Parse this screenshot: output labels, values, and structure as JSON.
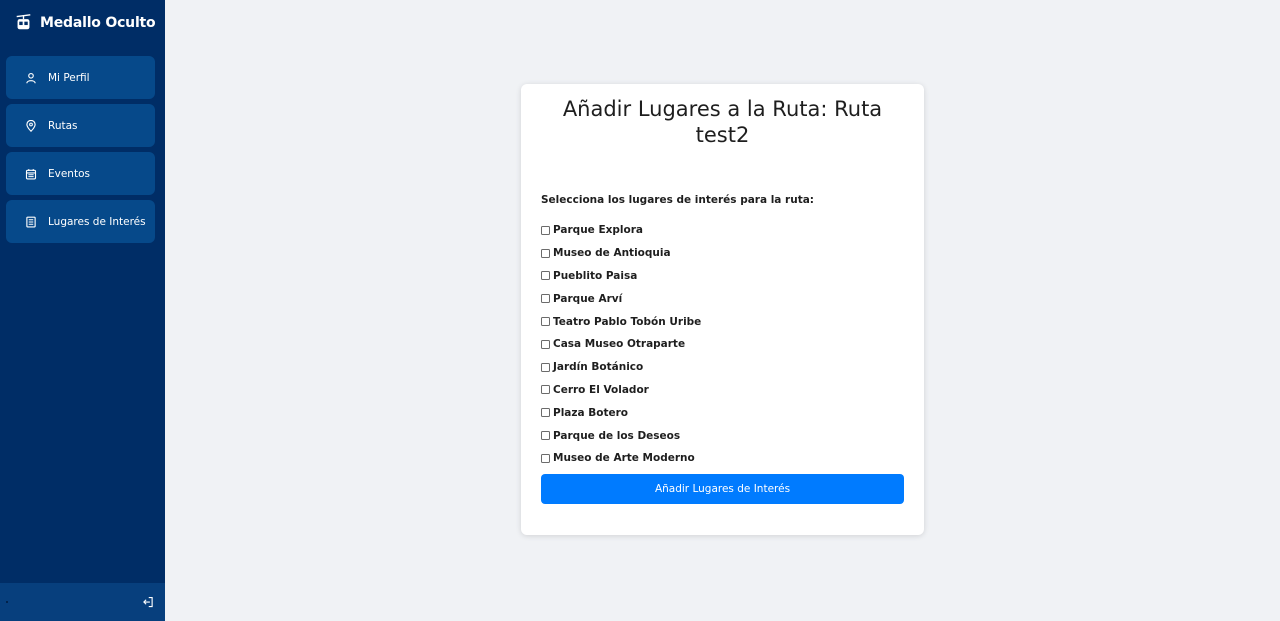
{
  "brand": {
    "name": "Medallo Oculto",
    "icon": "cable-car-icon"
  },
  "sidebar": {
    "items": [
      {
        "label": "Mi Perfil",
        "icon": "user-icon"
      },
      {
        "label": "Rutas",
        "icon": "map-pin-icon"
      },
      {
        "label": "Eventos",
        "icon": "calendar-icon"
      },
      {
        "label": "Lugares de Interés",
        "icon": "document-icon"
      }
    ],
    "footer": {
      "logout_icon": "logout-icon"
    }
  },
  "form": {
    "title": "Añadir Lugares a la Ruta: Ruta test2",
    "section_label": "Selecciona los lugares de interés para la ruta:",
    "places": [
      {
        "label": "Parque Explora",
        "checked": false
      },
      {
        "label": "Museo de Antioquia",
        "checked": false
      },
      {
        "label": "Pueblito Paisa",
        "checked": false
      },
      {
        "label": "Parque Arví",
        "checked": false
      },
      {
        "label": "Teatro Pablo Tobón Uribe",
        "checked": false
      },
      {
        "label": "Casa Museo Otraparte",
        "checked": false
      },
      {
        "label": "Jardín Botánico",
        "checked": false
      },
      {
        "label": "Cerro El Volador",
        "checked": false
      },
      {
        "label": "Plaza Botero",
        "checked": false
      },
      {
        "label": "Parque de los Deseos",
        "checked": false
      },
      {
        "label": "Museo de Arte Moderno",
        "checked": false
      }
    ],
    "submit_label": "Añadir Lugares de Interés"
  },
  "colors": {
    "sidebar_bg": "#002d66",
    "nav_item_bg": "#06498a",
    "page_bg": "#f0f2f5",
    "primary_button": "#007bff"
  }
}
